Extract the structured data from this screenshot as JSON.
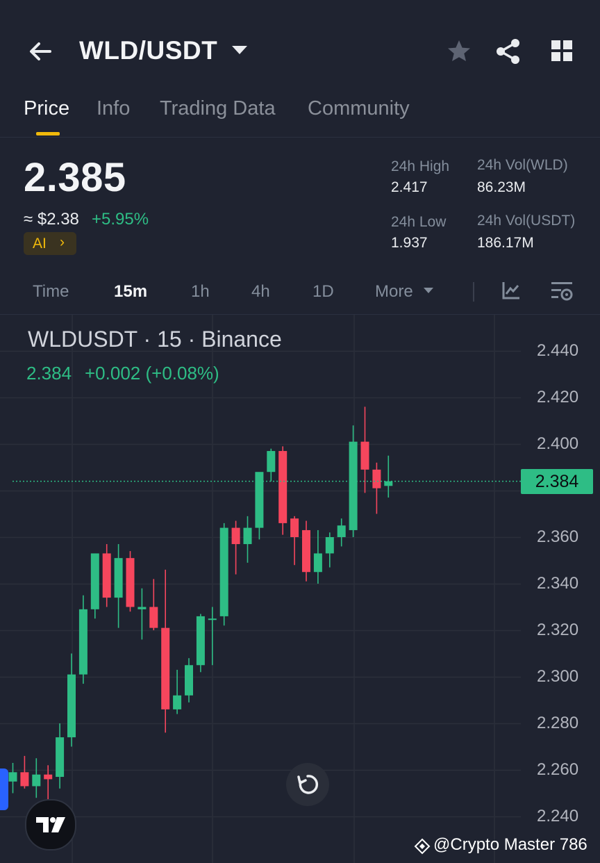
{
  "header": {
    "pair": "WLD/USDT"
  },
  "tabs": [
    {
      "label": "Price",
      "active": true
    },
    {
      "label": "Info",
      "active": false
    },
    {
      "label": "Trading Data",
      "active": false
    },
    {
      "label": "Community",
      "active": false
    }
  ],
  "ticker": {
    "price": "2.385",
    "usd_approx": "≈ $2.38",
    "change_pct": "+5.95%",
    "ai_label": "AI",
    "high_label": "24h High",
    "high_value": "2.417",
    "low_label": "24h Low",
    "low_value": "1.937",
    "vol_wld_label": "24h Vol(WLD)",
    "vol_wld_value": "86.23M",
    "vol_usdt_label": "24h Vol(USDT)",
    "vol_usdt_value": "186.17M"
  },
  "intervals": [
    {
      "label": "Time",
      "active": false
    },
    {
      "label": "15m",
      "active": true
    },
    {
      "label": "1h",
      "active": false
    },
    {
      "label": "4h",
      "active": false
    },
    {
      "label": "1D",
      "active": false
    },
    {
      "label": "More",
      "active": false
    }
  ],
  "chart_header": {
    "title": "WLDUSDT · 15 · Binance",
    "last": "2.384",
    "change": "+0.002 (+0.08%)"
  },
  "price_tag": "2.384",
  "y_axis_labels": [
    "2.440",
    "2.420",
    "2.400",
    "2.360",
    "2.340",
    "2.320",
    "2.300",
    "2.280",
    "2.260",
    "2.240"
  ],
  "watermark": "@Crypto Master 786",
  "colors": {
    "up": "#2ebd85",
    "down": "#f6465d",
    "accent": "#f0b90b",
    "background": "#1f2330"
  },
  "chart_data": {
    "type": "candlestick",
    "symbol": "WLDUSDT",
    "interval": "15",
    "exchange": "Binance",
    "ylim": [
      2.235,
      2.455
    ],
    "last_price": 2.384,
    "candles": [
      {
        "o": 2.255,
        "h": 2.263,
        "l": 2.25,
        "c": 2.259
      },
      {
        "o": 2.259,
        "h": 2.266,
        "l": 2.252,
        "c": 2.253
      },
      {
        "o": 2.253,
        "h": 2.265,
        "l": 2.248,
        "c": 2.258
      },
      {
        "o": 2.258,
        "h": 2.262,
        "l": 2.246,
        "c": 2.256
      },
      {
        "o": 2.257,
        "h": 2.28,
        "l": 2.252,
        "c": 2.274
      },
      {
        "o": 2.274,
        "h": 2.31,
        "l": 2.27,
        "c": 2.301
      },
      {
        "o": 2.301,
        "h": 2.335,
        "l": 2.297,
        "c": 2.329
      },
      {
        "o": 2.329,
        "h": 2.353,
        "l": 2.325,
        "c": 2.353
      },
      {
        "o": 2.353,
        "h": 2.357,
        "l": 2.33,
        "c": 2.334
      },
      {
        "o": 2.334,
        "h": 2.357,
        "l": 2.321,
        "c": 2.351
      },
      {
        "o": 2.351,
        "h": 2.354,
        "l": 2.328,
        "c": 2.33
      },
      {
        "o": 2.329,
        "h": 2.338,
        "l": 2.316,
        "c": 2.33
      },
      {
        "o": 2.33,
        "h": 2.342,
        "l": 2.32,
        "c": 2.321
      },
      {
        "o": 2.321,
        "h": 2.346,
        "l": 2.276,
        "c": 2.286
      },
      {
        "o": 2.286,
        "h": 2.303,
        "l": 2.284,
        "c": 2.292
      },
      {
        "o": 2.292,
        "h": 2.308,
        "l": 2.289,
        "c": 2.305
      },
      {
        "o": 2.305,
        "h": 2.327,
        "l": 2.302,
        "c": 2.326
      },
      {
        "o": 2.325,
        "h": 2.33,
        "l": 2.305,
        "c": 2.325
      },
      {
        "o": 2.326,
        "h": 2.366,
        "l": 2.322,
        "c": 2.364
      },
      {
        "o": 2.364,
        "h": 2.367,
        "l": 2.344,
        "c": 2.357
      },
      {
        "o": 2.357,
        "h": 2.369,
        "l": 2.349,
        "c": 2.364
      },
      {
        "o": 2.364,
        "h": 2.387,
        "l": 2.359,
        "c": 2.388
      },
      {
        "o": 2.388,
        "h": 2.398,
        "l": 2.384,
        "c": 2.397
      },
      {
        "o": 2.397,
        "h": 2.399,
        "l": 2.361,
        "c": 2.366
      },
      {
        "o": 2.368,
        "h": 2.369,
        "l": 2.348,
        "c": 2.36
      },
      {
        "o": 2.363,
        "h": 2.367,
        "l": 2.341,
        "c": 2.345
      },
      {
        "o": 2.345,
        "h": 2.363,
        "l": 2.34,
        "c": 2.353
      },
      {
        "o": 2.353,
        "h": 2.362,
        "l": 2.347,
        "c": 2.36
      },
      {
        "o": 2.36,
        "h": 2.368,
        "l": 2.356,
        "c": 2.365
      },
      {
        "o": 2.363,
        "h": 2.408,
        "l": 2.36,
        "c": 2.401
      },
      {
        "o": 2.401,
        "h": 2.416,
        "l": 2.379,
        "c": 2.389
      },
      {
        "o": 2.389,
        "h": 2.392,
        "l": 2.37,
        "c": 2.381
      },
      {
        "o": 2.382,
        "h": 2.395,
        "l": 2.377,
        "c": 2.384
      }
    ]
  }
}
